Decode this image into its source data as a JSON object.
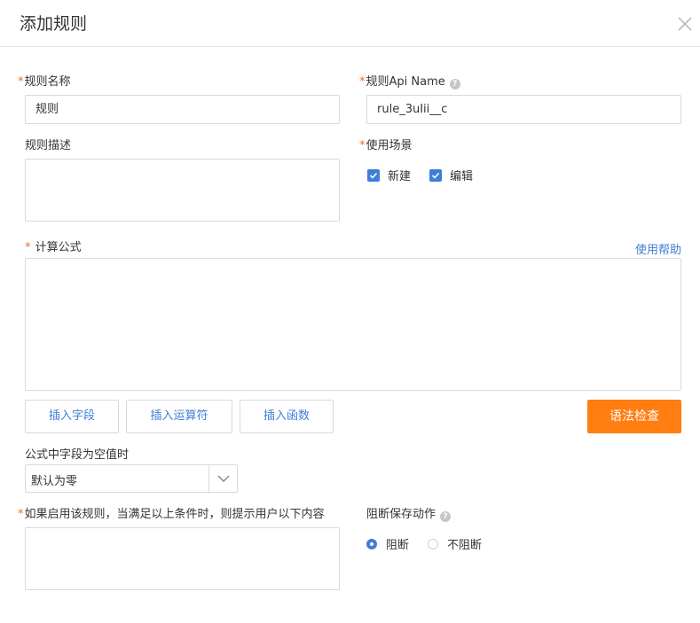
{
  "dialog": {
    "title": "添加规则"
  },
  "required_mark": "*",
  "help_icon_glyph": "?",
  "fields": {
    "rule_name": {
      "label": "规则名称",
      "value": "规则"
    },
    "api_name": {
      "label": "规则Api Name",
      "value": "rule_3uIii__c"
    },
    "description": {
      "label": "规则描述",
      "value": ""
    },
    "scenario": {
      "label": "使用场景",
      "options": [
        {
          "label": "新建",
          "checked": true
        },
        {
          "label": "编辑",
          "checked": true
        }
      ]
    },
    "formula": {
      "label": "计算公式",
      "help_link": "使用帮助",
      "value": ""
    },
    "empty_field": {
      "label": "公式中字段为空值时",
      "selected": "默认为零"
    },
    "prompt": {
      "label": "如果启用该规则，当满足以上条件时，则提示用户以下内容",
      "value": ""
    },
    "block_save": {
      "label": "阻断保存动作",
      "options": [
        {
          "label": "阻断",
          "selected": true
        },
        {
          "label": "不阻断",
          "selected": false
        }
      ]
    }
  },
  "buttons": {
    "insert_field": "插入字段",
    "insert_operator": "插入运算符",
    "insert_function": "插入函数",
    "syntax_check": "语法检查"
  },
  "colors": {
    "accent": "#3e7fd6",
    "primary_button": "#ff7d11",
    "required": "#f46a1e"
  }
}
